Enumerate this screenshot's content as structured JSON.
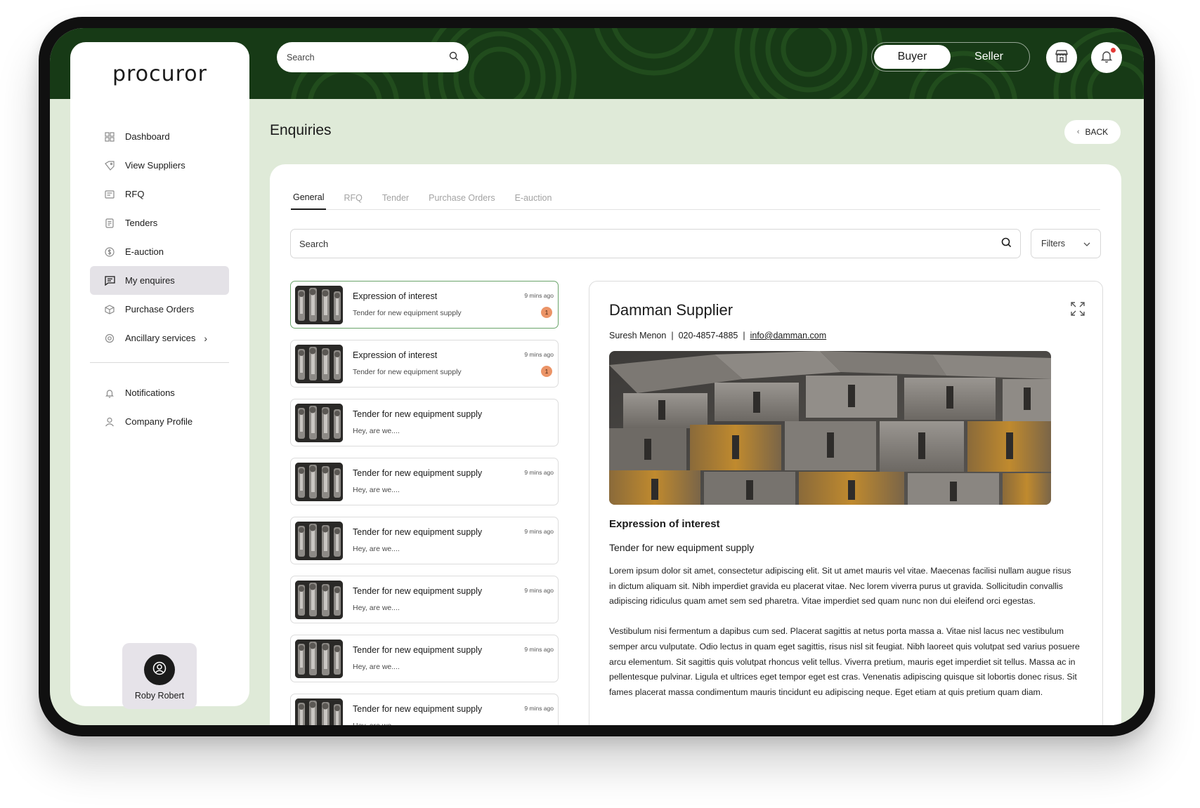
{
  "app": {
    "logo": "procuror",
    "search_placeholder": "Search",
    "roles": {
      "buyer": "Buyer",
      "seller": "Seller"
    }
  },
  "sidebar": {
    "items": [
      {
        "label": "Dashboard",
        "icon": "grid-icon",
        "active": false
      },
      {
        "label": "View Suppliers",
        "icon": "tag-icon",
        "active": false
      },
      {
        "label": "RFQ",
        "icon": "rfq-icon",
        "active": false
      },
      {
        "label": "Tenders",
        "icon": "tenders-icon",
        "active": false
      },
      {
        "label": "E-auction",
        "icon": "auction-icon",
        "active": false
      },
      {
        "label": "My enquires",
        "icon": "message-icon",
        "active": true
      },
      {
        "label": "Purchase Orders",
        "icon": "box-icon",
        "active": false
      },
      {
        "label": "Ancillary services",
        "icon": "settings-icon",
        "active": false
      }
    ],
    "secondary": [
      {
        "label": "Notifications",
        "icon": "bell-icon"
      },
      {
        "label": "Company Profile",
        "icon": "user-icon"
      }
    ],
    "user": {
      "name": "Roby Robert"
    }
  },
  "page": {
    "title": "Enquiries",
    "back_label": "BACK",
    "tabs": [
      "General",
      "RFQ",
      "Tender",
      "Purchase Orders",
      "E-auction"
    ],
    "active_tab": "General",
    "search_placeholder": "Search",
    "filters_label": "Filters"
  },
  "enquiries": [
    {
      "title": "Expression of interest",
      "subtitle": "Tender for new equipment supply",
      "time": "9 mins ago",
      "badge": "1",
      "selected": true
    },
    {
      "title": "Expression of interest",
      "subtitle": "Tender for new equipment supply",
      "time": "9 mins ago",
      "badge": "1",
      "selected": false
    },
    {
      "title": "Tender for new equipment supply",
      "subtitle": "Hey, are we....",
      "time": "",
      "badge": "",
      "selected": false
    },
    {
      "title": "Tender for new equipment supply",
      "subtitle": "Hey, are we....",
      "time": "9 mins ago",
      "badge": "",
      "selected": false
    },
    {
      "title": "Tender for new equipment supply",
      "subtitle": "Hey, are we....",
      "time": "9 mins ago",
      "badge": "",
      "selected": false
    },
    {
      "title": "Tender for new equipment supply",
      "subtitle": "Hey, are we....",
      "time": "9 mins ago",
      "badge": "",
      "selected": false
    },
    {
      "title": "Tender for new equipment supply",
      "subtitle": "Hey, are we....",
      "time": "9 mins ago",
      "badge": "",
      "selected": false
    },
    {
      "title": "Tender for new equipment supply",
      "subtitle": "Hey, are we....",
      "time": "9 mins ago",
      "badge": "",
      "selected": false
    }
  ],
  "detail": {
    "supplier_name": "Damman Supplier",
    "contact_name": "Suresh Menon",
    "phone": "020-4857-4885",
    "email": "info@damman.com",
    "heading": "Expression of interest",
    "subheading": "Tender for new equipment supply",
    "paragraphs": [
      "Lorem ipsum dolor sit amet, consectetur adipiscing elit. Sit ut amet mauris vel vitae. Maecenas facilisi nullam augue risus in dictum aliquam sit. Nibh imperdiet gravida eu placerat vitae. Nec lorem viverra purus ut gravida. Sollicitudin convallis adipiscing ridiculus quam amet sem sed pharetra. Vitae imperdiet sed quam nunc non dui eleifend orci egestas.",
      "Vestibulum nisi fermentum a dapibus cum sed. Placerat sagittis at netus porta massa a. Vitae nisl lacus nec vestibulum semper arcu vulputate. Odio lectus in quam eget sagittis, risus nisl sit feugiat. Nibh laoreet quis volutpat sed varius posuere arcu elementum. Sit sagittis quis volutpat rhoncus velit tellus. Viverra pretium, mauris eget imperdiet sit tellus. Massa ac in pellentesque pulvinar. Ligula et ultrices eget tempor eget est cras. Venenatis adipiscing quisque sit lobortis donec risus. Sit fames placerat massa condimentum mauris tincidunt eu adipiscing neque. Eget etiam at quis pretium quam diam."
    ]
  },
  "colors": {
    "header_green": "#173a16",
    "background_green": "#dfead8",
    "selected_border": "#6aa46a",
    "badge": "#eb9467"
  }
}
